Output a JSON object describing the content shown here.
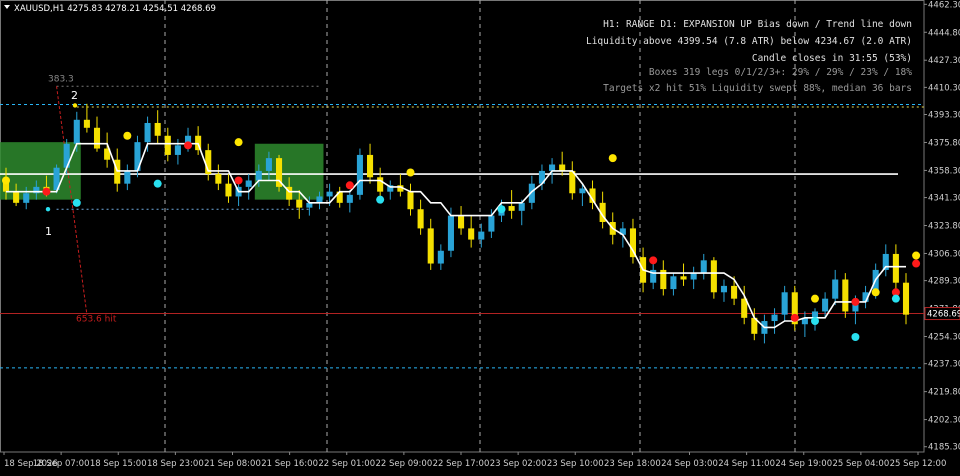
{
  "header": {
    "symbol_line": "XAUUSD,H1  4275.83 4278.21 4254.51 4268.69"
  },
  "info_panel": {
    "line1": "H1: RANGE   D1: EXPANSION UP   Bias down / Trend line down",
    "line2": "Liquidity  above 4399.54 (7.8 ATR)  below 4234.67 (2.0 ATR)",
    "line3": "Candle closes in 31:55 (53%)",
    "line4": "Boxes 319  legs 0/1/2/3+: 29% / 29% / 23% / 18%",
    "line5": "Targets  x2 hit 51%   Liquidity swept 88%, median 36 bars"
  },
  "annotations": {
    "level_383": "383.3",
    "label_2": "2",
    "label_1": "1",
    "label_hit": "653.6 hit"
  },
  "colors": {
    "background": "#000000",
    "bull_candle": "#29a3d6",
    "bear_candle": "#f5e000",
    "trend_line": "#ffffff",
    "box_fill": "#2e8b2e",
    "red_marker": "#ff1a1a",
    "yellow_marker": "#ffe600",
    "cyan_marker": "#29e0f0",
    "grid": "#6a6a6a",
    "liquidity_line": "#29b6f6",
    "price_line": "#b22222"
  },
  "chart_data": {
    "type": "candlestick",
    "symbol": "XAUUSD",
    "timeframe": "H1",
    "ohlc_header": {
      "open": 4275.83,
      "high": 4278.21,
      "low": 4254.51,
      "close": 4268.69
    },
    "ylim": [
      4182.0,
      4465.0
    ],
    "y_ticks": [
      "4462.30",
      "4444.80",
      "4427.30",
      "4410.30",
      "4393.30",
      "4375.80",
      "4358.30",
      "4341.30",
      "4323.80",
      "4306.30",
      "4289.30",
      "4271.80",
      "4254.30",
      "4237.30",
      "4219.80",
      "4202.30",
      "4185.30"
    ],
    "current_price": "4268.69",
    "x_ticks": [
      "18 Sep 2026",
      "18 Sep 07:00",
      "18 Sep 15:00",
      "18 Sep 23:00",
      "21 Sep 08:00",
      "21 Sep 16:00",
      "22 Sep 01:00",
      "22 Sep 09:00",
      "22 Sep 17:00",
      "23 Sep 02:00",
      "23 Sep 10:00",
      "23 Sep 18:00",
      "24 Sep 03:00",
      "24 Sep 11:00",
      "24 Sep 19:00",
      "25 Sep 04:00",
      "25 Sep 12:00"
    ],
    "candles": [
      [
        4352,
        4360,
        4340,
        4345
      ],
      [
        4345,
        4350,
        4336,
        4338
      ],
      [
        4338,
        4348,
        4334,
        4344
      ],
      [
        4344,
        4352,
        4340,
        4348
      ],
      [
        4348,
        4355,
        4342,
        4346
      ],
      [
        4346,
        4362,
        4344,
        4360
      ],
      [
        4360,
        4378,
        4356,
        4375
      ],
      [
        4375,
        4395,
        4370,
        4390
      ],
      [
        4390,
        4400,
        4382,
        4385
      ],
      [
        4385,
        4392,
        4370,
        4372
      ],
      [
        4372,
        4382,
        4360,
        4365
      ],
      [
        4365,
        4372,
        4345,
        4350
      ],
      [
        4350,
        4362,
        4346,
        4358
      ],
      [
        4358,
        4380,
        4354,
        4376
      ],
      [
        4376,
        4392,
        4370,
        4388
      ],
      [
        4388,
        4396,
        4375,
        4380
      ],
      [
        4380,
        4385,
        4364,
        4368
      ],
      [
        4368,
        4378,
        4362,
        4374
      ],
      [
        4374,
        4385,
        4370,
        4380
      ],
      [
        4380,
        4386,
        4368,
        4371
      ],
      [
        4371,
        4375,
        4352,
        4356
      ],
      [
        4356,
        4362,
        4346,
        4350
      ],
      [
        4350,
        4356,
        4338,
        4342
      ],
      [
        4342,
        4352,
        4336,
        4348
      ],
      [
        4348,
        4356,
        4340,
        4352
      ],
      [
        4352,
        4362,
        4348,
        4358
      ],
      [
        4358,
        4370,
        4352,
        4366
      ],
      [
        4366,
        4368,
        4345,
        4348
      ],
      [
        4348,
        4354,
        4336,
        4340
      ],
      [
        4340,
        4346,
        4328,
        4335
      ],
      [
        4335,
        4342,
        4330,
        4338
      ],
      [
        4338,
        4345,
        4334,
        4342
      ],
      [
        4342,
        4350,
        4336,
        4345
      ],
      [
        4345,
        4348,
        4335,
        4338
      ],
      [
        4338,
        4346,
        4332,
        4343
      ],
      [
        4343,
        4372,
        4340,
        4368
      ],
      [
        4368,
        4375,
        4350,
        4354
      ],
      [
        4354,
        4360,
        4340,
        4345
      ],
      [
        4345,
        4352,
        4340,
        4349
      ],
      [
        4349,
        4356,
        4342,
        4345
      ],
      [
        4345,
        4350,
        4330,
        4334
      ],
      [
        4334,
        4340,
        4318,
        4322
      ],
      [
        4322,
        4328,
        4296,
        4300
      ],
      [
        4300,
        4312,
        4296,
        4308
      ],
      [
        4308,
        4335,
        4304,
        4330
      ],
      [
        4330,
        4336,
        4318,
        4322
      ],
      [
        4322,
        4330,
        4310,
        4315
      ],
      [
        4315,
        4325,
        4310,
        4320
      ],
      [
        4320,
        4334,
        4316,
        4330
      ],
      [
        4330,
        4340,
        4326,
        4336
      ],
      [
        4336,
        4346,
        4328,
        4333
      ],
      [
        4333,
        4340,
        4324,
        4338
      ],
      [
        4338,
        4355,
        4334,
        4350
      ],
      [
        4350,
        4362,
        4346,
        4358
      ],
      [
        4358,
        4366,
        4350,
        4362
      ],
      [
        4362,
        4370,
        4355,
        4358
      ],
      [
        4358,
        4364,
        4340,
        4344
      ],
      [
        4344,
        4350,
        4336,
        4347
      ],
      [
        4347,
        4352,
        4334,
        4338
      ],
      [
        4338,
        4345,
        4322,
        4326
      ],
      [
        4326,
        4332,
        4312,
        4318
      ],
      [
        4318,
        4326,
        4310,
        4322
      ],
      [
        4322,
        4328,
        4300,
        4304
      ],
      [
        4304,
        4310,
        4282,
        4288
      ],
      [
        4288,
        4300,
        4284,
        4296
      ],
      [
        4296,
        4302,
        4280,
        4284
      ],
      [
        4284,
        4294,
        4280,
        4292
      ],
      [
        4292,
        4300,
        4286,
        4290
      ],
      [
        4290,
        4298,
        4284,
        4294
      ],
      [
        4294,
        4306,
        4290,
        4302
      ],
      [
        4302,
        4304,
        4278,
        4282
      ],
      [
        4282,
        4290,
        4276,
        4286
      ],
      [
        4286,
        4292,
        4274,
        4278
      ],
      [
        4278,
        4286,
        4262,
        4266
      ],
      [
        4266,
        4272,
        4252,
        4256
      ],
      [
        4256,
        4268,
        4250,
        4264
      ],
      [
        4264,
        4272,
        4256,
        4268
      ],
      [
        4268,
        4286,
        4264,
        4282
      ],
      [
        4282,
        4286,
        4258,
        4262
      ],
      [
        4262,
        4270,
        4254,
        4266
      ],
      [
        4266,
        4272,
        4258,
        4270
      ],
      [
        4270,
        4282,
        4266,
        4278
      ],
      [
        4278,
        4296,
        4274,
        4290
      ],
      [
        4290,
        4294,
        4266,
        4270
      ],
      [
        4270,
        4280,
        4262,
        4276
      ],
      [
        4276,
        4286,
        4272,
        4282
      ],
      [
        4282,
        4300,
        4278,
        4296
      ],
      [
        4296,
        4312,
        4292,
        4306
      ],
      [
        4306,
        4312,
        4284,
        4288
      ],
      [
        4288,
        4294,
        4262,
        4268
      ]
    ],
    "trend_line": [
      4345,
      4345,
      4345,
      4345,
      4345,
      4345,
      4360,
      4375,
      4375,
      4375,
      4375,
      4358,
      4358,
      4358,
      4375,
      4375,
      4375,
      4375,
      4375,
      4375,
      4358,
      4358,
      4358,
      4345,
      4345,
      4352,
      4352,
      4352,
      4345,
      4345,
      4338,
      4338,
      4338,
      4345,
      4345,
      4352,
      4352,
      4352,
      4348,
      4348,
      4345,
      4345,
      4338,
      4338,
      4330,
      4330,
      4330,
      4330,
      4330,
      4338,
      4338,
      4338,
      4345,
      4350,
      4358,
      4358,
      4358,
      4350,
      4340,
      4330,
      4322,
      4318,
      4308,
      4296,
      4294,
      4294,
      4294,
      4294,
      4294,
      4294,
      4294,
      4294,
      4290,
      4280,
      4266,
      4260,
      4260,
      4264,
      4264,
      4266,
      4266,
      4266,
      4276,
      4276,
      4276,
      4276,
      4290,
      4298,
      4298,
      4298
    ],
    "red_markers": [
      [
        4,
        4345
      ],
      [
        18,
        4374
      ],
      [
        23,
        4352
      ],
      [
        34,
        4349
      ],
      [
        64,
        4302
      ],
      [
        78,
        4266
      ],
      [
        84,
        4276
      ],
      [
        88,
        4282
      ],
      [
        90,
        4300
      ]
    ],
    "yellow_markers": [
      [
        0,
        4352
      ],
      [
        12,
        4380
      ],
      [
        23,
        4376
      ],
      [
        40,
        4357
      ],
      [
        60,
        4366
      ],
      [
        80,
        4278
      ],
      [
        86,
        4282
      ],
      [
        90,
        4305
      ]
    ],
    "cyan_markers": [
      [
        7,
        4338
      ],
      [
        15,
        4350
      ],
      [
        37,
        4340
      ],
      [
        49,
        4334
      ],
      [
        80,
        4264
      ],
      [
        84,
        4254
      ],
      [
        88,
        4278
      ]
    ],
    "levels": {
      "white_horizontal": 4356.0,
      "liquidity_above": 4399.54,
      "liquidity_below": 4234.67,
      "price_line": 4268.69
    }
  }
}
